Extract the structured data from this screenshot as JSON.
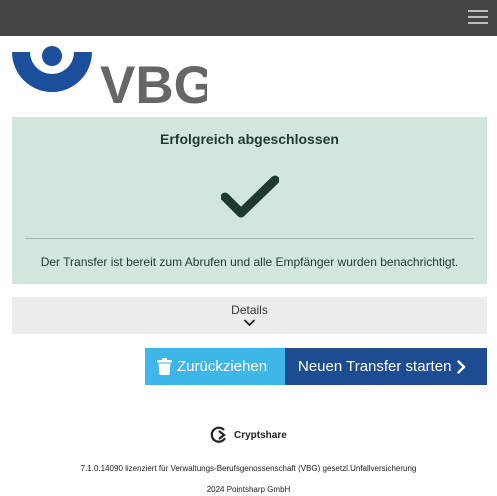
{
  "header": {
    "menu_icon": "hamburger-menu-icon"
  },
  "logo": {
    "text": "VBG",
    "colors": {
      "emblem": "#1b4f9c",
      "text": "#666666"
    }
  },
  "status": {
    "title": "Erfolgreich abgeschlossen",
    "icon": "checkmark-icon",
    "message": "Der Transfer ist bereit zum Abrufen und alle Empfänger wurden benachrichtigt.",
    "background": "#d1e7dd"
  },
  "details": {
    "label": "Details",
    "icon": "chevron-down-icon"
  },
  "actions": {
    "withdraw_label": "Zurückziehen",
    "withdraw_icon": "trash-icon",
    "new_transfer_label": "Neuen Transfer starten",
    "new_transfer_icon": "chevron-right-icon",
    "colors": {
      "withdraw": "#3fb6ea",
      "new_transfer": "#1d4c91"
    }
  },
  "footer": {
    "brand": "Cryptshare",
    "license": "7.1.0.14090 lizenziert für Verwaltungs-Berufsgenossenschaft (VBG) gesetzl.Unfallversicherung",
    "copyright": "2024 Pointsharp GmbH"
  }
}
